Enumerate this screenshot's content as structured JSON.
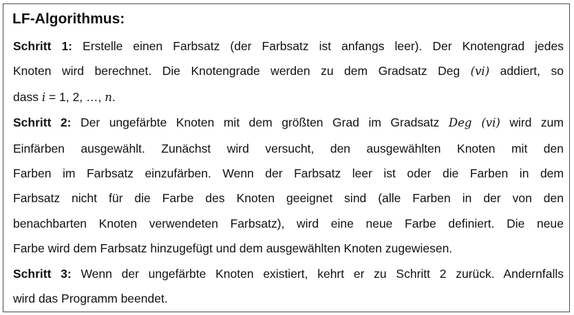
{
  "title": "LF-Algorithmus:",
  "step1": {
    "label": "Schritt 1:",
    "line1_text": " Erstelle einen Farbsatz (der Farbsatz ist anfangs leer). Der Knotengrad jedes",
    "line2_text": "Knoten wird berechnet. Die Knotengrade werden zu dem Gradsatz Deg ",
    "line2_math": "(vi)",
    "line2_tail": " addiert, so",
    "line3_pre": "dass ",
    "line3_math_i": "i",
    "line3_mid": " = 1, 2, …, ",
    "line3_math_n": "n",
    "line3_tail": "."
  },
  "step2": {
    "label": "Schritt 2:",
    "line1_text": " Der ungefärbte Knoten mit dem größten Grad im Gradsatz ",
    "line1_math": "Deg (vi)",
    "line1_tail": " wird zum",
    "line2": "Einfärben ausgewählt. Zunächst wird versucht, den ausgewählten Knoten mit den",
    "line3": "Farben im Farbsatz einzufärben. Wenn der Farbsatz leer ist oder die Farben in dem",
    "line4": "Farbsatz nicht für die Farbe des Knoten geeignet sind (alle Farben in der von den",
    "line5": "benachbarten Knoten verwendeten Farbsatz), wird eine neue Farbe definiert. Die neue",
    "line6": "Farbe wird dem Farbsatz hinzugefügt und dem ausgewählten Knoten zugewiesen."
  },
  "step3": {
    "label": "Schritt 3:",
    "line1_text": " Wenn der ungefärbte Knoten existiert, kehrt er zu Schritt 2 zurück. Andernfalls",
    "line2": "wird das Programm beendet."
  }
}
